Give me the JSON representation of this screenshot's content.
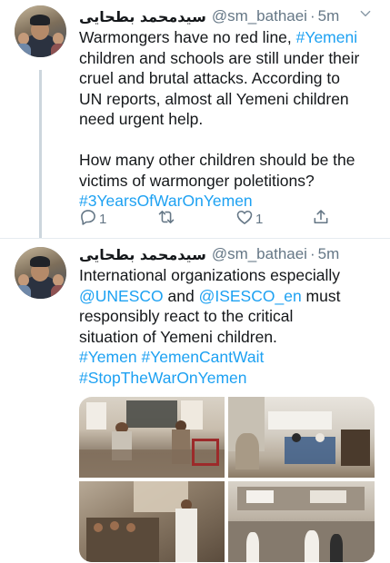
{
  "tweets": [
    {
      "author_name": "سیدمحمد بطحایی",
      "handle": "@sm_bathaei",
      "separator": "·",
      "time": "5m",
      "text_lines": [
        [
          {
            "t": "Warmongers have no red line, "
          },
          {
            "t": "#Yemeni",
            "link": true
          }
        ],
        [
          {
            "t": "children and schools are still under their"
          }
        ],
        [
          {
            "t": "cruel and brutal attacks. According to"
          }
        ],
        [
          {
            "t": "UN reports, almost all Yemeni children"
          }
        ],
        [
          {
            "t": "need urgent help."
          }
        ],
        [],
        [
          {
            "t": "How many other children should be the"
          }
        ],
        [
          {
            "t": "victims of warmonger poletitions?"
          }
        ],
        [
          {
            "t": "#3YearsOfWarOnYemen",
            "link": true
          }
        ]
      ],
      "reply_count": "1",
      "retweet_count": "",
      "like_count": "1"
    },
    {
      "author_name": "سیدمحمد بطحایی",
      "handle": "@sm_bathaei",
      "separator": "·",
      "time": "5m",
      "text_lines": [
        [
          {
            "t": "International organizations especially"
          }
        ],
        [
          {
            "t": "@UNESCO",
            "link": true
          },
          {
            "t": " and "
          },
          {
            "t": "@ISESCO_en",
            "link": true
          },
          {
            "t": " must"
          }
        ],
        [
          {
            "t": "responsibly react to the critical"
          }
        ],
        [
          {
            "t": "situation of Yemeni children."
          }
        ],
        [
          {
            "t": "#Yemen",
            "link": true
          },
          {
            "t": " "
          },
          {
            "t": "#YemenCantWait",
            "link": true
          }
        ],
        [
          {
            "t": "#StopTheWarOnYemen",
            "link": true
          }
        ]
      ],
      "photos": [
        "photo-classroom-rubble",
        "photo-damaged-classroom",
        "photo-boys-in-ruins",
        "photo-girls-in-ruined-building"
      ]
    }
  ],
  "colors": {
    "link": "#1da1f2",
    "secondary": "#657786",
    "text": "#14171a",
    "thread_line": "#ccd6dd",
    "divider": "#e6ecf0"
  },
  "icons": [
    "chevron-down-icon",
    "reply-icon",
    "retweet-icon",
    "like-icon",
    "share-icon"
  ]
}
